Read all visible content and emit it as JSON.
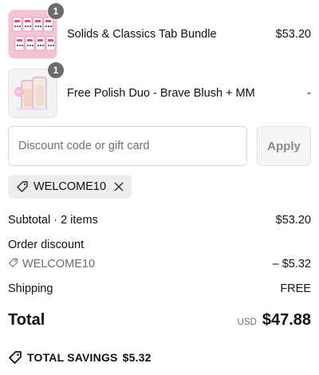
{
  "line_items": [
    {
      "name": "Solids & Classics Tab Bundle",
      "price": "$53.20",
      "quantity": "1",
      "image_icon": "nail-tab-sheets-thumbnail"
    },
    {
      "name": "Free Polish Duo - Brave Blush + MM",
      "price": "-",
      "quantity": "1",
      "image_icon": "polish-bottles-thumbnail"
    }
  ],
  "discount": {
    "placeholder": "Discount code or gift card",
    "value": "",
    "apply_label": "Apply",
    "applied_code": "WELCOME10"
  },
  "summary": {
    "subtotal_label": "Subtotal · 2 items",
    "subtotal_value": "$53.20",
    "order_discount_label": "Order discount",
    "discount_code": "WELCOME10",
    "discount_value": "– $5.32",
    "shipping_label": "Shipping",
    "shipping_value": "FREE",
    "total_label": "Total",
    "currency": "USD",
    "total_value": "$47.88",
    "savings_label": "TOTAL SAVINGS",
    "savings_value": "$5.32"
  },
  "colors": {
    "thumbnail_pink": "#f4c3d6",
    "badge": "#6b6b6b",
    "chip_bg": "#ededed",
    "muted_text": "#6e6e6e"
  }
}
